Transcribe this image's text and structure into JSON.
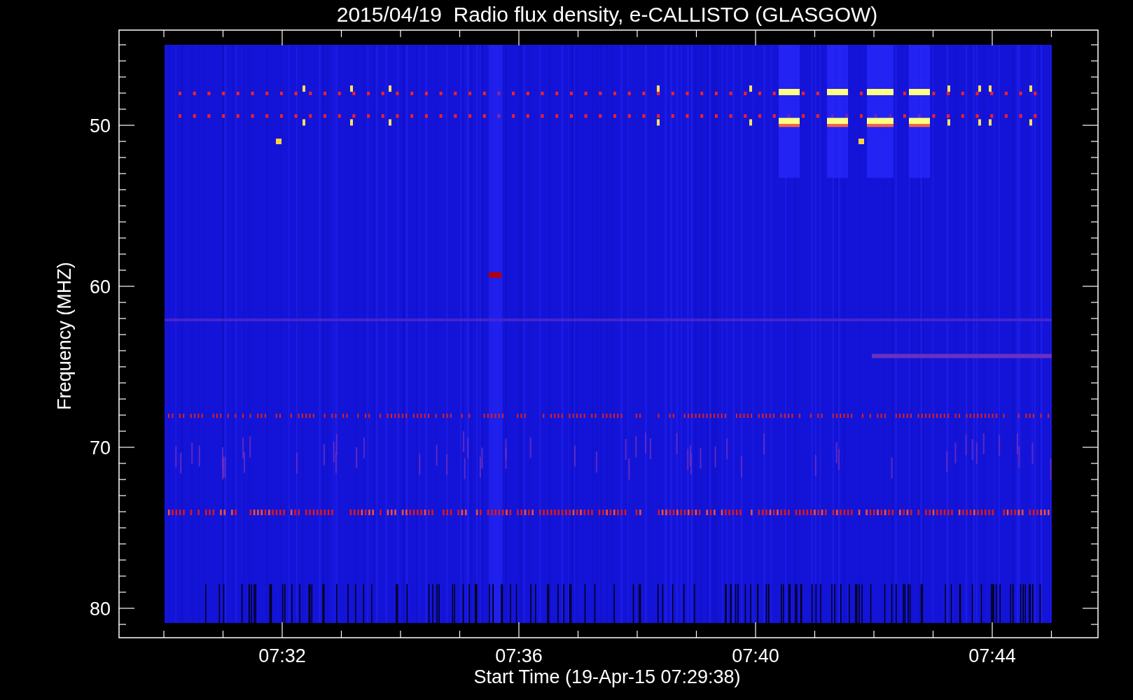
{
  "title": "2015/04/19  Radio flux density, e-CALLISTO (GLASGOW)",
  "y_axis": {
    "label": "Frequency (MHZ)",
    "ticks": [
      "50",
      "60",
      "70",
      "80"
    ]
  },
  "x_axis": {
    "label": "Start Time (19-Apr-15 07:29:38)",
    "ticks": [
      "07:32",
      "07:36",
      "07:40",
      "07:44"
    ]
  }
}
